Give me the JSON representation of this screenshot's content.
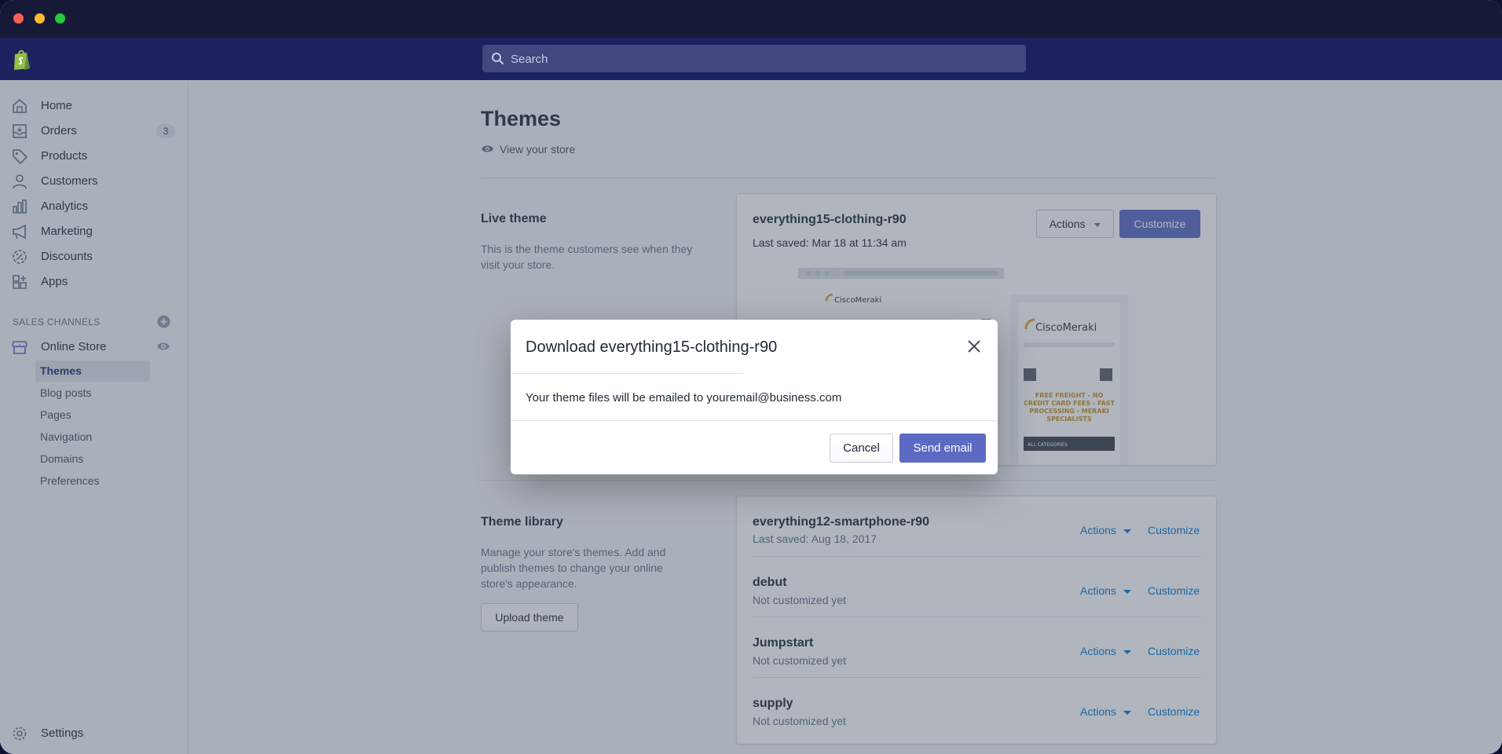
{
  "app": {
    "search_placeholder": "Search",
    "brand": "shopify-logo"
  },
  "sidebar": {
    "items": [
      {
        "label": "Home",
        "icon": "home-icon"
      },
      {
        "label": "Orders",
        "icon": "orders-icon",
        "badge": "3"
      },
      {
        "label": "Products",
        "icon": "tag-icon"
      },
      {
        "label": "Customers",
        "icon": "person-icon"
      },
      {
        "label": "Analytics",
        "icon": "bar-chart-icon"
      },
      {
        "label": "Marketing",
        "icon": "megaphone-icon"
      },
      {
        "label": "Discounts",
        "icon": "discount-icon"
      },
      {
        "label": "Apps",
        "icon": "apps-icon"
      }
    ],
    "sales_channels_heading": "SALES CHANNELS",
    "online_store": "Online Store",
    "sub_items": [
      "Themes",
      "Blog posts",
      "Pages",
      "Navigation",
      "Domains",
      "Preferences"
    ],
    "active_sub": "Themes",
    "settings": "Settings"
  },
  "page": {
    "title": "Themes",
    "view_store": "View your store",
    "live_theme": {
      "heading": "Live theme",
      "description": "This is the theme customers see when they visit your store.",
      "name": "everything15-clothing-r90",
      "saved": "Last saved: Mar 18 at 11:34 am",
      "actions": "Actions",
      "customize": "Customize",
      "preview_brand": "CiscoMeraki",
      "preview_promo": "FREE FREIGHT - NO CREDIT CARD FEES - FAST PROCESSING - MERAKI SPECIALISTS",
      "preview_categories": "ALL CATEGORIES"
    },
    "library": {
      "heading": "Theme library",
      "description": "Manage your store's themes. Add and publish themes to change your online store's appearance.",
      "upload": "Upload theme",
      "themes": [
        {
          "name": "everything12-smartphone-r90",
          "sub": "Last saved: Aug 18, 2017",
          "actions": "Actions",
          "customize": "Customize"
        },
        {
          "name": "debut",
          "sub": "Not customized yet",
          "actions": "Actions",
          "customize": "Customize"
        },
        {
          "name": "Jumpstart",
          "sub": "Not customized yet",
          "actions": "Actions",
          "customize": "Customize"
        },
        {
          "name": "supply",
          "sub": "Not customized yet",
          "actions": "Actions",
          "customize": "Customize"
        }
      ]
    }
  },
  "modal": {
    "title": "Download everything15-clothing-r90",
    "message": "Your theme files will be emailed to youremail@business.com",
    "cancel": "Cancel",
    "send": "Send email"
  },
  "colors": {
    "primary": "#5c6ac4",
    "topbar": "#1c2260",
    "link": "#007ace"
  }
}
